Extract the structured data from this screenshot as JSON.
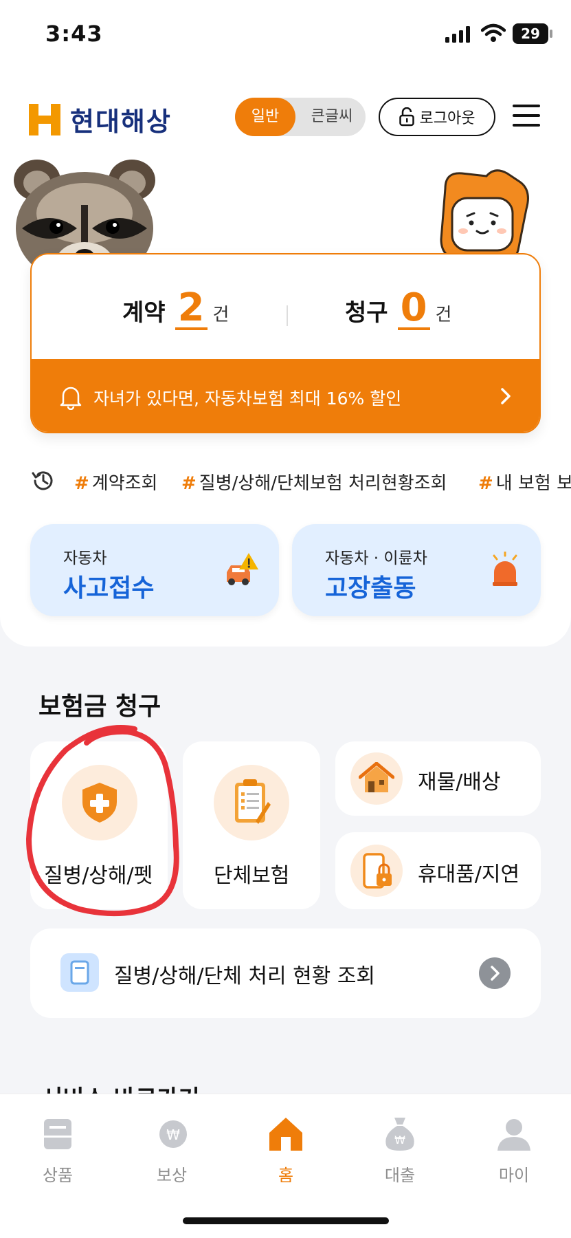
{
  "status_bar": {
    "time": "3:43",
    "battery": "29"
  },
  "header": {
    "brand": "현대해상",
    "mode_on": "일반",
    "mode_off": "큰글씨",
    "logout": "로그아웃"
  },
  "summary": {
    "contract_label": "계약",
    "contract_count": "2",
    "claim_label": "청구",
    "claim_count": "0",
    "unit": "건",
    "banner_text": "자녀가 있다면, 자동차보험 최대 16% 할인"
  },
  "tags": [
    "계약조회",
    "질병/상해/단체보험 처리현황조회",
    "내 보험 보"
  ],
  "quick": [
    {
      "sub": "자동차",
      "main": "사고접수",
      "icon": "car-alert-icon"
    },
    {
      "sub": "자동차 · 이륜차",
      "main": "고장출동",
      "icon": "siren-icon"
    }
  ],
  "claims": {
    "title": "보험금 청구",
    "items": [
      {
        "label": "질병/상해/펫",
        "icon": "shield-plus-icon"
      },
      {
        "label": "단체보험",
        "icon": "clipboard-icon"
      },
      {
        "label": "재물/배상",
        "icon": "house-icon"
      },
      {
        "label": "휴대품/지연",
        "icon": "phone-lock-icon"
      }
    ],
    "status_link": "질병/상해/단체 처리 현황 조회"
  },
  "next_section_title": "서비스 바로가기",
  "bottom_nav": [
    {
      "label": "상품",
      "active": false
    },
    {
      "label": "보상",
      "active": false
    },
    {
      "label": "홈",
      "active": true
    },
    {
      "label": "대출",
      "active": false
    },
    {
      "label": "마이",
      "active": false
    }
  ],
  "colors": {
    "accent": "#ef7d0a",
    "navy": "#17307c",
    "blue": "#1664d8",
    "annotation": "#e8333a"
  }
}
